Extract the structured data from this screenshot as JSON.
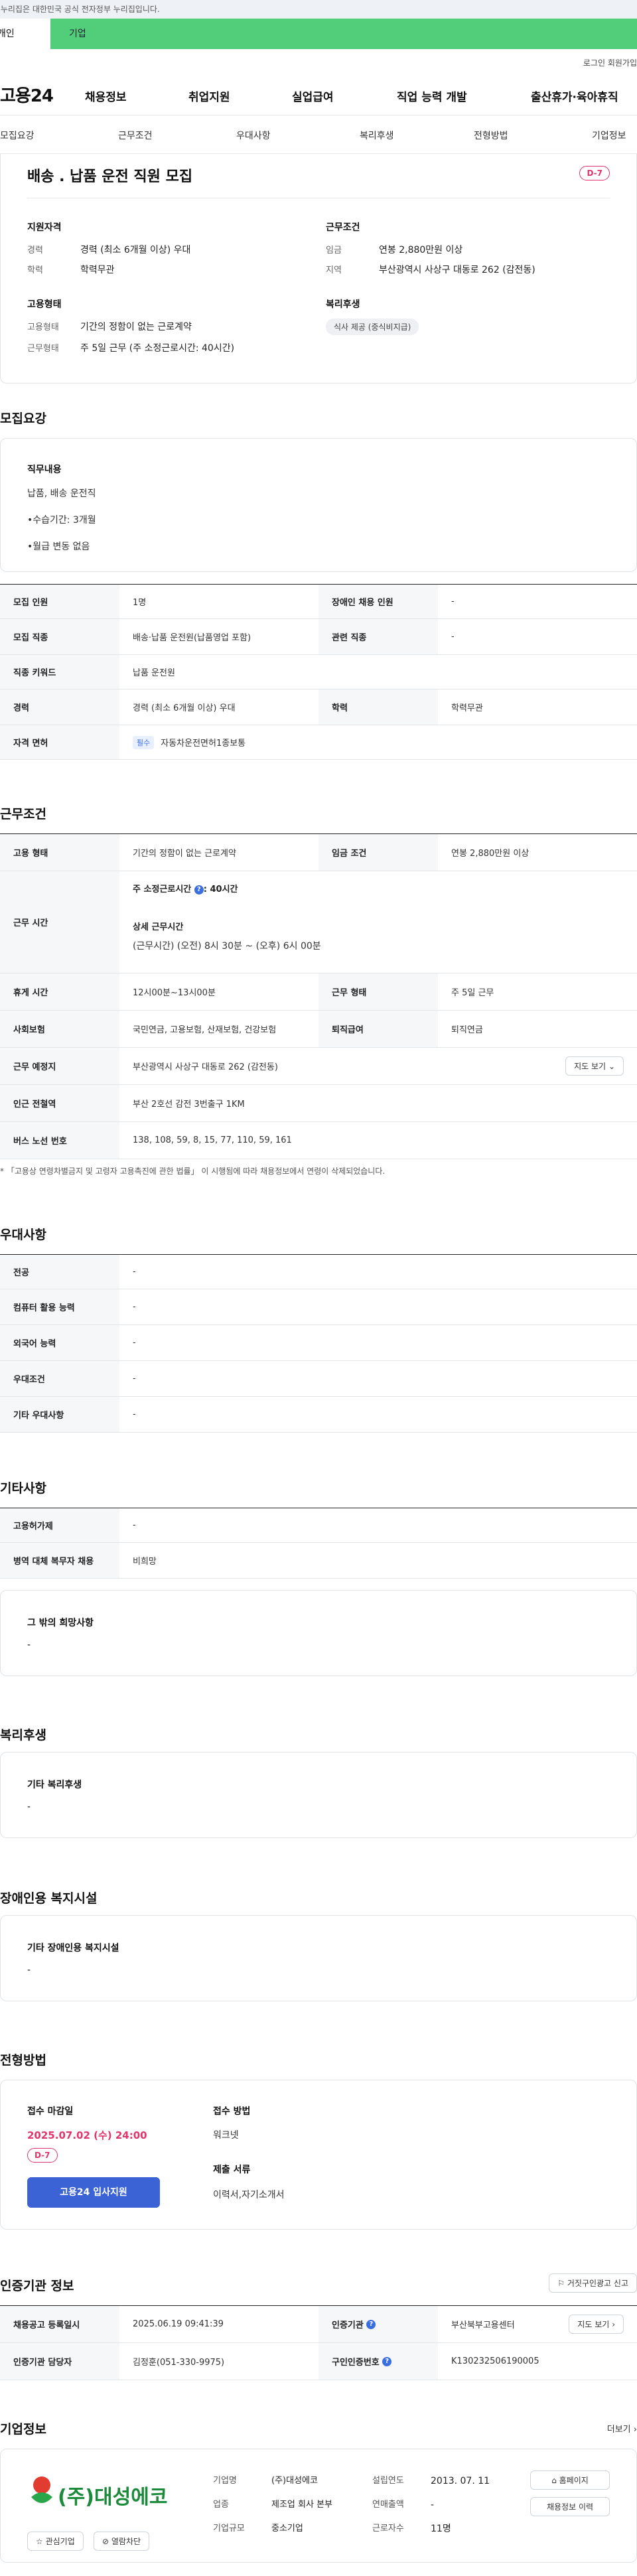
{
  "gov_banner": "이 누리집은 대한민국 공식 전자정부 누리집입니다.",
  "user_tabs": {
    "personal": "개인",
    "company": "기업"
  },
  "util": {
    "login": "로그인",
    "join": "회원가입"
  },
  "gnb": {
    "logo": "고용24",
    "menu": [
      "채용정보",
      "취업지원",
      "실업급여",
      "직업 능력 개발",
      "출산휴가·육아휴직"
    ]
  },
  "subnav": [
    "모집요강",
    "근무조건",
    "우대사항",
    "복리후생",
    "전형방법",
    "기업정보"
  ],
  "job": {
    "title": "배송 . 납품 운전 직원 모집",
    "dday": "D-7",
    "qual_title": "지원자격",
    "qual": [
      {
        "k": "경력",
        "v": "경력 (최소 6개월 이상) 우대"
      },
      {
        "k": "학력",
        "v": "학력무관"
      }
    ],
    "emp_title": "고용형태",
    "emp": [
      {
        "k": "고용형태",
        "v": "기간의 정함이 없는 근로계약"
      },
      {
        "k": "근무형태",
        "v": "주 5일 근무 (주 소정근로시간: 40시간)"
      }
    ],
    "cond_title": "근무조건",
    "cond": [
      {
        "k": "임금",
        "v": "연봉 2,880만원 이상"
      },
      {
        "k": "지역",
        "v": "부산광역시 사상구 대동로 262 (감전동)"
      }
    ],
    "welfare_title": "복리후생",
    "welfare_pill": "식사 제공 (중식비지급)"
  },
  "recruit": {
    "title": "모집요강",
    "duty_title": "직무내용",
    "duty_lines": [
      "납품, 배송 운전직",
      "•수습기간: 3개월",
      "•월급 변동 없음"
    ],
    "rows": [
      {
        "k1": "모집 인원",
        "v1": "1명",
        "k2": "장애인 채용 인원",
        "v2": "-"
      },
      {
        "k1": "모집 직종",
        "v1": "배송·납품 운전원(납품영업 포함)",
        "k2": "관련 직종",
        "v2": "-"
      },
      {
        "k1": "직종 키워드",
        "v1": "납품 운전원"
      },
      {
        "k1": "경력",
        "v1": "경력 (최소 6개월 이상) 우대",
        "k2": "학력",
        "v2": "학력무관"
      },
      {
        "k1": "자격 면허",
        "v1_tag": "필수",
        "v1": "자동차운전면허1종보통"
      }
    ]
  },
  "work": {
    "title": "근무조건",
    "type_k": "고용 형태",
    "type_v": "기간의 정함이 없는 근로계약",
    "wage_k": "임금 조건",
    "wage_v": "연봉 2,880만원 이상",
    "hours_k": "근무 시간",
    "hours_l1": "주 소정근로시간",
    "hours_l1v": ": 40시간",
    "hours_l2": "상세 근무시간",
    "hours_l3": "(근무시간) (오전) 8시 30분 ~ (오후) 6시 00분",
    "rest_k": "휴게 시간",
    "rest_v": "12시00분~13시00분",
    "form_k": "근무 형태",
    "form_v": "주 5일 근무",
    "ins_k": "사회보험",
    "ins_v": "국민연금, 고용보험, 산재보험, 건강보험",
    "ret_k": "퇴직급여",
    "ret_v": "퇴직연금",
    "place_k": "근무 예정지",
    "place_v": "부산광역시 사상구 대동로 262 (감전동)",
    "map_btn": "지도 보기",
    "subway_k": "인근 전철역",
    "subway_v": "부산 2호선 감전 3번출구 1KM",
    "bus_k": "버스 노선 번호",
    "bus_v": "138, 108, 59, 8, 15, 77, 110, 59, 161",
    "note": "* 「고용상 연령차별금지 및 고령자 고용촉진에 관한 법률」 이 시행됨에 따라 채용정보에서 연령이 삭제되었습니다."
  },
  "pref": {
    "title": "우대사항",
    "rows": [
      {
        "k": "전공",
        "v": "-"
      },
      {
        "k": "컴퓨터 활용 능력",
        "v": "-"
      },
      {
        "k": "외국어 능력",
        "v": "-"
      },
      {
        "k": "우대조건",
        "v": "-"
      },
      {
        "k": "기타 우대사항",
        "v": "-"
      }
    ]
  },
  "etc": {
    "title": "기타사항",
    "rows": [
      {
        "k": "고용허가제",
        "v": "-"
      },
      {
        "k": "병역 대체 복무자 채용",
        "v": "비희망"
      }
    ],
    "hope_title": "그 밖의 희망사항",
    "hope_v": "-"
  },
  "welfare": {
    "title": "복리후생",
    "sub": "기타 복리후생",
    "v": "-"
  },
  "disab": {
    "title": "장애인용 복지시설",
    "sub": "기타 장애인용 복지시설",
    "v": "-"
  },
  "select": {
    "title": "전형방법",
    "deadline_k": "접수 마감일",
    "deadline_v": "2025.07.02 (수) 24:00",
    "dday": "D-7",
    "apply_btn": "고용24 입사지원",
    "method_k": "접수 방법",
    "method_v": "워크넷",
    "docs_k": "제출 서류",
    "docs_v": "이력서,자기소개서"
  },
  "cert": {
    "title": "인증기관 정보",
    "report_btn": "거짓구인광고 신고",
    "reg_k": "채용공고 등록일시",
    "reg_v": "2025.06.19 09:41:39",
    "org_k": "인증기관",
    "org_v": "부산북부고용센터",
    "org_map": "지도 보기",
    "mgr_k": "인증기관 담당자",
    "mgr_v": "김정훈(051-330-9975)",
    "id_k": "구인인증번호",
    "id_v": "K130232506190005"
  },
  "company": {
    "title": "기업정보",
    "more": "더보기",
    "logo_text": "(주)대성에코",
    "fav": "관심기업",
    "block": "열람차단",
    "name_k": "기업명",
    "name_v": "(주)대성에코",
    "est_k": "설립연도",
    "est_v": "2013. 07. 11",
    "ind_k": "업종",
    "ind_v": "제조업 회사 본부",
    "sales_k": "연매출액",
    "sales_v": "-",
    "size_k": "기업규모",
    "size_v": "중소기업",
    "emp_k": "근로자수",
    "emp_v": "11명",
    "home_btn": "홈페이지",
    "jobs_btn": "채용정보 이력"
  }
}
